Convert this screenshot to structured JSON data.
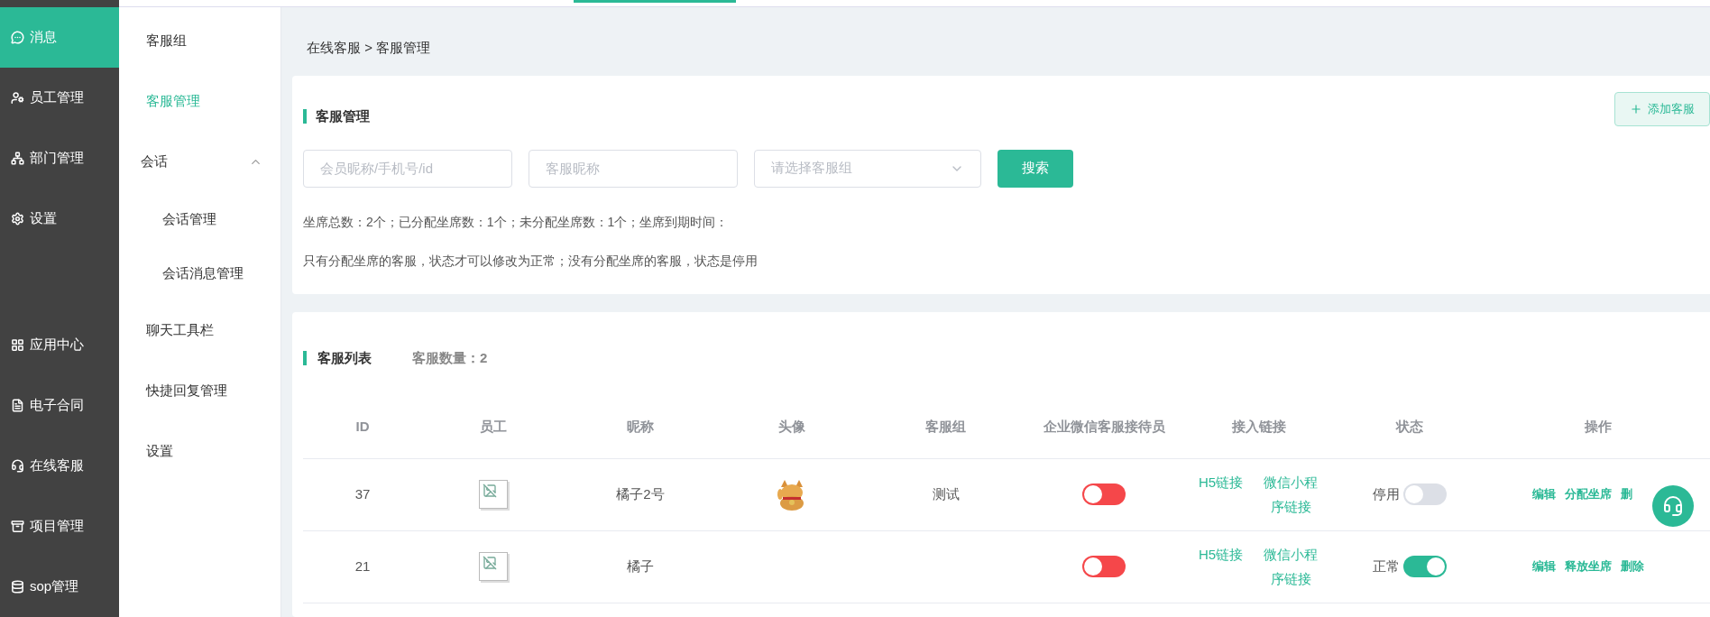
{
  "nav": {
    "top_items": [
      {
        "label": "消息",
        "kind": "message",
        "selected": true
      },
      {
        "label": "员工管理",
        "kind": "staff",
        "selected": false
      },
      {
        "label": "部门管理",
        "kind": "department",
        "selected": false
      },
      {
        "label": "设置",
        "kind": "settings",
        "selected": false
      }
    ],
    "bottom_items": [
      {
        "label": "应用中心",
        "kind": "apps",
        "selected": false
      },
      {
        "label": "电子合同",
        "kind": "contract",
        "selected": false
      },
      {
        "label": "在线客服",
        "kind": "service",
        "selected": false
      },
      {
        "label": "项目管理",
        "kind": "project",
        "selected": false
      },
      {
        "label": "sop管理",
        "kind": "sop",
        "selected": false
      }
    ]
  },
  "subnav": [
    {
      "label": "客服组",
      "selected": false
    },
    {
      "label": "客服管理",
      "selected": true
    },
    {
      "label": "会话",
      "expanded": true,
      "children": [
        {
          "label": "会话管理",
          "selected": false
        },
        {
          "label": "会话消息管理",
          "selected": false
        }
      ]
    },
    {
      "label": "聊天工具栏",
      "selected": false
    },
    {
      "label": "快捷回复管理",
      "selected": false
    },
    {
      "label": "设置",
      "selected": false
    }
  ],
  "breadcrumb": "在线客服 > 客服管理",
  "filter_card": {
    "title": "客服管理",
    "add_button": "添加客服",
    "fields": [
      {
        "kind": "input",
        "placeholder": "会员昵称/手机号/id"
      },
      {
        "kind": "input",
        "placeholder": "客服昵称"
      },
      {
        "kind": "select",
        "placeholder": "请选择客服组"
      }
    ],
    "search_button": "搜索",
    "stats": "坐席总数：2个；已分配坐席数：1个；未分配坐席数：1个；坐席到期时间：",
    "note": "只有分配坐席的客服，状态才可以修改为正常；没有分配坐席的客服，状态是停用"
  },
  "list_card": {
    "title": "客服列表",
    "count": "客服数量：2",
    "columns": [
      "ID",
      "员工",
      "昵称",
      "头像",
      "客服组",
      "企业微信客服接待员",
      "接入链接",
      "状态",
      "操作"
    ],
    "rows": [
      {
        "id": "37",
        "nickname": "橘子2号",
        "avatar": {
          "kind": "picture"
        },
        "group": "测试",
        "wecom_on": false,
        "links": [
          "H5链接",
          "微信小程序链接"
        ],
        "status": "停用",
        "status_on": false,
        "actions": [
          "编辑",
          "分配坐席",
          "删"
        ]
      },
      {
        "id": "21",
        "nickname": "橘子",
        "wecom_on": false,
        "links": [
          "H5链接",
          "微信小程序链接"
        ],
        "status": "正常",
        "status_on": true,
        "actions": [
          "编辑",
          "释放坐席",
          "删除"
        ]
      }
    ]
  }
}
